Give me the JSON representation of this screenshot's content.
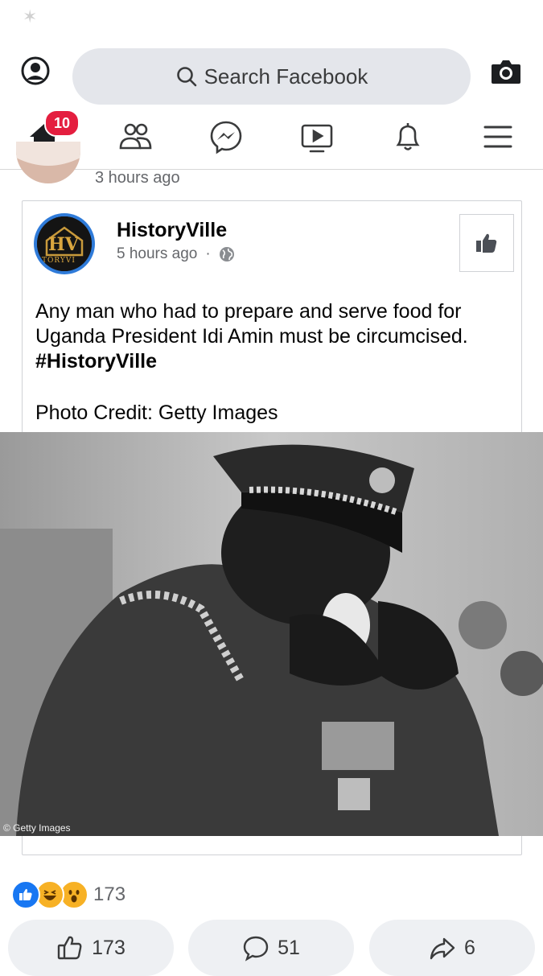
{
  "app": {
    "status_glyph": "✶"
  },
  "header": {
    "search_placeholder": "Search Facebook",
    "icons": [
      "profile-icon",
      "search-icon",
      "camera-icon"
    ]
  },
  "nav": {
    "items": [
      "home",
      "friends",
      "messenger",
      "watch",
      "notifications",
      "menu"
    ],
    "home_badge": "10",
    "accent": "#1877f2",
    "badge_color": "#e41e3f"
  },
  "previous_post": {
    "time": "3 hours ago"
  },
  "shared_post": {
    "page_name": "HistoryVille",
    "logo_text": "HV",
    "logo_subtext": "TORYVI",
    "time": "5 hours ago",
    "separator": "·",
    "text": "Any man who had to prepare and serve food for Uganda President Idi Amin must be circumcised.",
    "hashtag": "#HistoryVille",
    "credit": "Photo Credit: Getty Images",
    "photo_watermark": "© Getty Images"
  },
  "reactions": {
    "icons": [
      "like",
      "haha",
      "wow"
    ],
    "count": "173"
  },
  "actions": {
    "like_count": "173",
    "comment_count": "51",
    "share_count": "6"
  }
}
